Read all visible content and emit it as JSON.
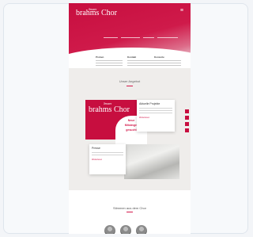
{
  "website": {
    "logo": {
      "main": "brahms Chor",
      "small": "Jenaer"
    },
    "hero_tagline": "~~~~~~~~~~~~~~~~~~~~~~~~",
    "info_columns": [
      {
        "heading": "Proben"
      },
      {
        "heading": "Kontakt"
      },
      {
        "heading": "Konzerte"
      }
    ],
    "section_title": "Unser Angebot",
    "promo_lines": [
      "Neue",
      "Mitsänger",
      "gesucht"
    ],
    "card_right": {
      "title": "Aktuelle Projekte",
      "more": "Weiterlesen"
    },
    "card_left": {
      "title": "Presse",
      "more": "Weiterlesen"
    },
    "bottom_title": "Stimmen aus dem Chor",
    "colors": {
      "brand_red": "#c70e3f",
      "band_bg": "#efedeb"
    },
    "icons": [
      "menu-icon"
    ]
  }
}
